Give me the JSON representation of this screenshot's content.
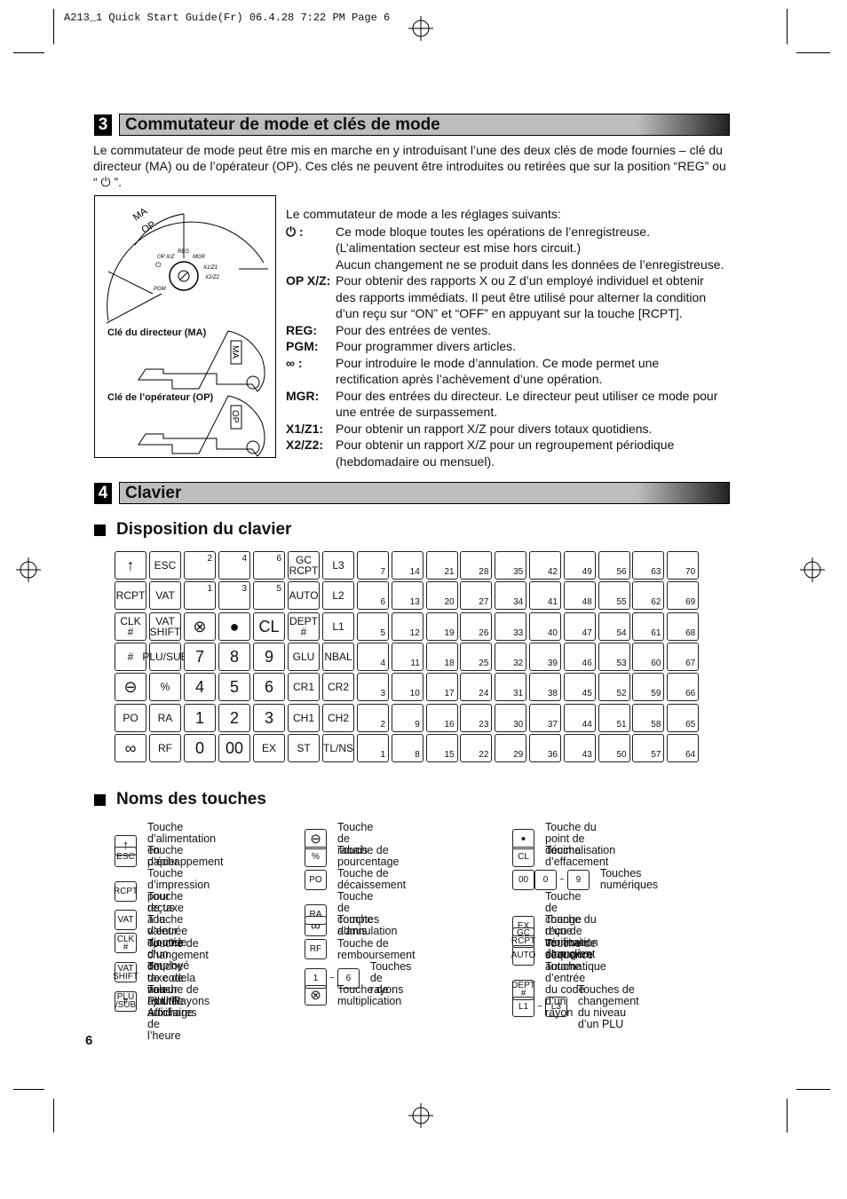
{
  "header": {
    "print_line": "A213_1 Quick Start Guide(Fr)   06.4.28 7:22 PM  Page 6"
  },
  "section3": {
    "number": "3",
    "title": "Commutateur de mode et clés de mode",
    "intro": "Le commutateur de mode peut être mis en marche en y introduisant l’une des deux clés de mode fournies – clé du directeur (MA) ou de l’opérateur (OP). Ces clés ne peuvent être introduites ou retirées que sur la position “REG” ou “ ⏻ ”.",
    "diagram": {
      "arc_ma": "MA",
      "arc_op": "OP",
      "positions": [
        "REG",
        "OP X/Z",
        "⏻",
        "MGR",
        "X1/Z1",
        "X2/Z2",
        "PGM"
      ],
      "key_ma_label": "Clé du directeur (MA)",
      "key_ma_tag": "MA",
      "key_op_label": "Clé de l’opérateur (OP)",
      "key_op_tag": "OP"
    },
    "settings_intro": "Le commutateur de mode a les réglages suivants:",
    "settings": [
      {
        "key": "⏻ :",
        "lines": [
          "Ce mode bloque toutes les opérations de l’enregistreuse.",
          "(L’alimentation secteur est mise hors circuit.)",
          "Aucun changement ne se produit dans les données de l’enregistreuse."
        ]
      },
      {
        "key": "OP X/Z:",
        "lines": [
          "Pour obtenir des rapports X ou Z d’un employé individuel et obtenir",
          "des rapports immédiats. Il peut être utilisé pour alterner la condition",
          "d’un reçu sur “ON” et “OFF” en appuyant sur la touche [RCPT]."
        ]
      },
      {
        "key": "REG:",
        "lines": [
          "Pour des entrées de ventes."
        ]
      },
      {
        "key": "PGM:",
        "lines": [
          "Pour programmer divers articles."
        ]
      },
      {
        "key": "∞ :",
        "lines": [
          "Pour introduire le mode d’annulation. Ce mode permet une",
          "rectification après l’achèvement d’une opération."
        ]
      },
      {
        "key": "MGR:",
        "lines": [
          "Pour des entrées du directeur. Le directeur peut utiliser ce mode pour",
          "une entrée de surpassement."
        ]
      },
      {
        "key": "X1/Z1:",
        "lines": [
          "Pour obtenir un rapport X/Z pour divers totaux quotidiens."
        ]
      },
      {
        "key": "X2/Z2:",
        "lines": [
          "Pour obtenir un rapport X/Z pour un regroupement périodique",
          "(hebdomadaire ou mensuel)."
        ]
      }
    ]
  },
  "section4": {
    "number": "4",
    "title": "Clavier",
    "layout_title": "Disposition du clavier",
    "names_title": "Noms des touches"
  },
  "keyboard": {
    "rows": [
      [
        "↑",
        "ESC",
        "#2",
        "#4",
        "#6",
        "GC\nRCPT",
        "L3"
      ],
      [
        "RCPT",
        "VAT",
        "#1",
        "#3",
        "#5",
        "AUTO",
        "L2"
      ],
      [
        "CLK\n#",
        "VAT\nSHIFT",
        "⊗",
        "●",
        "CL",
        "DEPT\n#",
        "L1"
      ],
      [
        "#",
        "PLU/SUB",
        "7",
        "8",
        "9",
        "GLU",
        "NBAL"
      ],
      [
        "⊖",
        "%",
        "4",
        "5",
        "6",
        "CR1",
        "CR2"
      ],
      [
        "PO",
        "RA",
        "1",
        "2",
        "3",
        "CH1",
        "CH2"
      ],
      [
        "∞",
        "RF",
        "0",
        "00",
        "EX",
        "ST",
        "TL/NS"
      ]
    ],
    "plu_numbers": [
      [
        7,
        14,
        21,
        28,
        35,
        42,
        49,
        56,
        63,
        70
      ],
      [
        6,
        13,
        20,
        27,
        34,
        41,
        48,
        55,
        62,
        69
      ],
      [
        5,
        12,
        19,
        26,
        33,
        40,
        47,
        54,
        61,
        68
      ],
      [
        4,
        11,
        18,
        25,
        32,
        39,
        46,
        53,
        60,
        67
      ],
      [
        3,
        10,
        17,
        24,
        31,
        38,
        45,
        52,
        59,
        66
      ],
      [
        2,
        9,
        16,
        23,
        30,
        37,
        44,
        51,
        58,
        65
      ],
      [
        1,
        8,
        15,
        22,
        29,
        36,
        43,
        50,
        57,
        64
      ]
    ]
  },
  "key_names": [
    [
      {
        "keys": [
          "↑"
        ],
        "text": "Touche d’alimentation en\npapier"
      },
      {
        "keys": [
          "ESC"
        ],
        "text": "Touche d’échappement"
      },
      {
        "keys": [
          "RCPT"
        ],
        "text": "Touche d’impression pour\nreçus"
      },
      {
        "keys": [
          "VAT"
        ],
        "text": "Touche de taxe à la valeur\najoutée"
      },
      {
        "keys": [
          "CLK\n#"
        ],
        "text": "Touche d’entrée du code\nd’un employé"
      },
      {
        "keys": [
          "VAT\nSHIFT"
        ],
        "text": "Touche de changement de\ntaxe de la valeur ajoutée"
      },
      {
        "keys": [
          "#"
        ],
        "text": "Touche de code non-additif/\nAffichage de l’heure"
      },
      {
        "keys": [
          "PLU\n/SUB"
        ],
        "text": "Touche de PLU/Rayons\nauxiliaires"
      }
    ],
    [
      {
        "keys": [
          "⊖"
        ],
        "text": "Touche de rabais"
      },
      {
        "keys": [
          "%"
        ],
        "text": "Touche de pourcentage"
      },
      {
        "keys": [
          "PO"
        ],
        "text": "Touche de décaissement"
      },
      {
        "keys": [
          "RA"
        ],
        "text": "Touche de comptes admis"
      },
      {
        "keys": [
          "∞"
        ],
        "text": "Touche d’annulation"
      },
      {
        "keys": [
          "RF"
        ],
        "text": "Touche de remboursement"
      },
      {
        "keys": [
          "#1",
          "~",
          "#6"
        ],
        "text": "Touches de rayons"
      },
      {
        "keys": [
          "⊗"
        ],
        "text": "Touche de multiplication"
      }
    ],
    [
      {
        "keys": [
          "•"
        ],
        "text": "Touche du point de\ndécimalisation"
      },
      {
        "keys": [
          "CL"
        ],
        "text": "Touche d’effacement"
      },
      {
        "keys": [
          "00",
          "0",
          "~",
          "9"
        ],
        "text": "Touches numériques"
      },
      {
        "keys": [
          "EX"
        ],
        "text": "Touche de change d’une\nmonnaie étrangère"
      },
      {
        "keys": [
          "GC\nRCPT"
        ],
        "text": "Touche du reçu de vérification\nd’un client"
      },
      {
        "keys": [
          "AUTO"
        ],
        "text": "Touche de séquence automatique"
      },
      {
        "keys": [
          "DEPT\n#"
        ],
        "text": "Touche d’entrée du code\nd’un rayon"
      },
      {
        "keys": [
          "L1",
          "~",
          "L3"
        ],
        "text": "Touches de changement\ndu niveau d’un PLU"
      }
    ]
  ],
  "page_number": "6"
}
